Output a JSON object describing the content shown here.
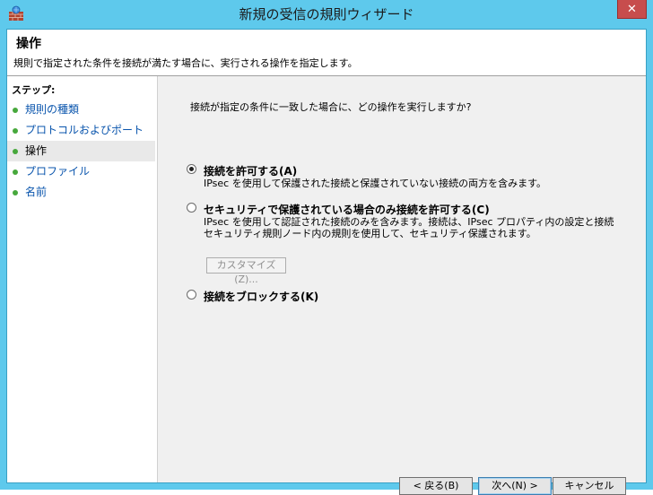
{
  "window": {
    "title": "新規の受信の規則ウィザード",
    "close_label": "✕"
  },
  "header": {
    "title": "操作",
    "description": "規則で指定された条件を接続が満たす場合に、実行される操作を指定します。"
  },
  "sidebar": {
    "label": "ステップ:",
    "items": [
      {
        "label": "規則の種類",
        "active": false
      },
      {
        "label": "プロトコルおよびポート",
        "active": false
      },
      {
        "label": "操作",
        "active": true
      },
      {
        "label": "プロファイル",
        "active": false
      },
      {
        "label": "名前",
        "active": false
      }
    ]
  },
  "main": {
    "question": "接続が指定の条件に一致した場合に、どの操作を実行しますか?",
    "options": [
      {
        "label": "接続を許可する(A)",
        "desc1": "IPsec を使用して保護された接続と保護されていない接続の両方を含みます。",
        "desc2": "",
        "checked": true
      },
      {
        "label": "セキュリティで保護されている場合のみ接続を許可する(C)",
        "desc1": "IPsec を使用して認証された接続のみを含みます。接続は、IPsec プロパティ内の設定と接続",
        "desc2": "セキュリティ規則ノード内の規則を使用して、セキュリティ保護されます。",
        "checked": false
      },
      {
        "label": "接続をブロックする(K)",
        "desc1": "",
        "desc2": "",
        "checked": false
      }
    ],
    "customize_label": "カスタマイズ(Z)..."
  },
  "buttons": {
    "back": "< 戻る(B)",
    "next": "次へ(N) >",
    "cancel": "キャンセル"
  },
  "colors": {
    "frame": "#5ec9ec",
    "link": "#0a55ad",
    "step_dot": "#47a83c",
    "close": "#c74d4d"
  }
}
